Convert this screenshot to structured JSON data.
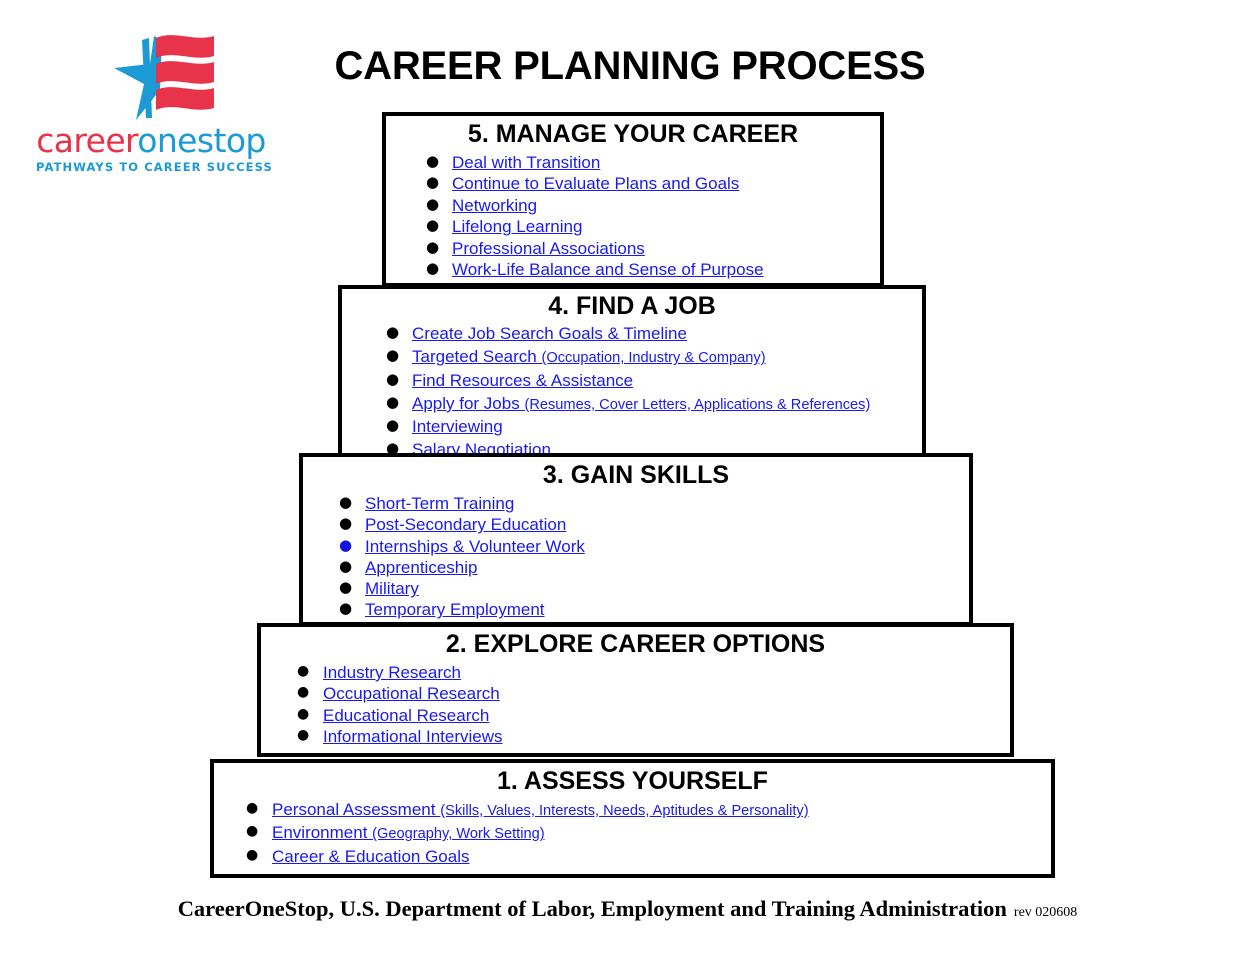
{
  "document": {
    "title": "CAREER PLANNING PROCESS"
  },
  "logo": {
    "name": "careeronestop-logo",
    "word_first": "career",
    "word_second": "onestop",
    "tagline": "PATHWAYS TO CAREER SUCCESS",
    "colors": {
      "red": "#e8344a",
      "blue": "#1b9ad6"
    },
    "mark": "waving-flag-with-star-icon"
  },
  "colors": {
    "link": "#1a1aee",
    "border": "#000000",
    "text": "#000000",
    "background": "#ffffff"
  },
  "pyramid": {
    "tiers": [
      {
        "id": "tier-5",
        "number": 5,
        "title": "5. MANAGE YOUR CAREER",
        "items": [
          {
            "text": "Deal with Transition",
            "paren": "",
            "bullet_color": "black"
          },
          {
            "text": "Continue to Evaluate Plans and Goals",
            "paren": "",
            "bullet_color": "black"
          },
          {
            "text": "Networking",
            "paren": "",
            "bullet_color": "black"
          },
          {
            "text": "Lifelong Learning",
            "paren": "",
            "bullet_color": "black"
          },
          {
            "text": "Professional Associations",
            "paren": "",
            "bullet_color": "black"
          },
          {
            "text": "Work-Life Balance and Sense of Purpose",
            "paren": "",
            "bullet_color": "black"
          }
        ]
      },
      {
        "id": "tier-4",
        "number": 4,
        "title": "4. FIND A JOB",
        "items": [
          {
            "text": "Create Job Search Goals & Timeline",
            "paren": "",
            "bullet_color": "black"
          },
          {
            "text": "Targeted Search ",
            "paren": "(Occupation, Industry & Company)",
            "bullet_color": "black"
          },
          {
            "text": "Find Resources & Assistance",
            "paren": "",
            "bullet_color": "black"
          },
          {
            "text": "Apply for Jobs ",
            "paren": "(Resumes, Cover Letters, Applications & References)",
            "bullet_color": "black"
          },
          {
            "text": "Interviewing",
            "paren": "",
            "bullet_color": "black"
          },
          {
            "text": "Salary Negotiation",
            "paren": "",
            "bullet_color": "black"
          }
        ]
      },
      {
        "id": "tier-3",
        "number": 3,
        "title": "3. GAIN SKILLS",
        "items": [
          {
            "text": "Short-Term Training",
            "paren": "",
            "bullet_color": "black"
          },
          {
            "text": "Post-Secondary Education",
            "paren": "",
            "bullet_color": "black"
          },
          {
            "text": "Internships & Volunteer Work",
            "paren": "",
            "bullet_color": "blue"
          },
          {
            "text": "Apprenticeship",
            "paren": "",
            "bullet_color": "black"
          },
          {
            "text": "Military",
            "paren": "",
            "bullet_color": "black"
          },
          {
            "text": "Temporary Employment",
            "paren": "",
            "bullet_color": "black"
          }
        ]
      },
      {
        "id": "tier-2",
        "number": 2,
        "title": "2. EXPLORE CAREER OPTIONS",
        "items": [
          {
            "text": "Industry Research",
            "paren": "",
            "bullet_color": "black"
          },
          {
            "text": "Occupational Research",
            "paren": "",
            "bullet_color": "black"
          },
          {
            "text": "Educational Research",
            "paren": "",
            "bullet_color": "black"
          },
          {
            "text": "Informational Interviews",
            "paren": "",
            "bullet_color": "black"
          }
        ]
      },
      {
        "id": "tier-1",
        "number": 1,
        "title": "1. ASSESS YOURSELF",
        "items": [
          {
            "text": "Personal Assessment ",
            "paren": "(Skills, Values, Interests, Needs, Aptitudes & Personality)",
            "bullet_color": "black"
          },
          {
            "text": "Environment ",
            "paren": "(Geography, Work Setting)",
            "bullet_color": "black"
          },
          {
            "text": "Career & Education Goals",
            "paren": "",
            "bullet_color": "black"
          }
        ]
      }
    ]
  },
  "footer": {
    "attribution": "CareerOneStop, U.S. Department of Labor, Employment and Training Administration",
    "revision": "rev 020608"
  }
}
